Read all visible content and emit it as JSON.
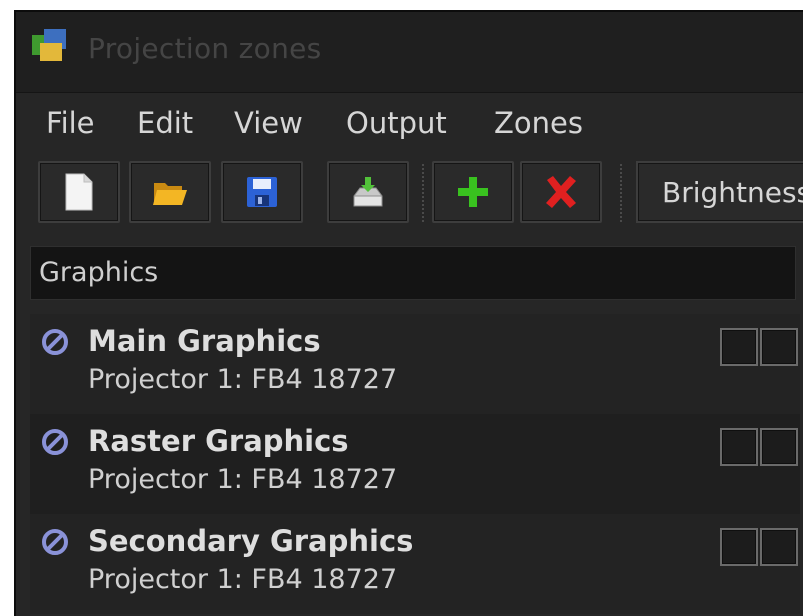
{
  "window": {
    "title": "Projection zones"
  },
  "menu": {
    "items": [
      "File",
      "Edit",
      "View",
      "Output",
      "Zones"
    ]
  },
  "toolbar": {
    "buttons": [
      {
        "icon": "new-document-icon"
      },
      {
        "icon": "open-folder-icon"
      },
      {
        "icon": "save-disk-icon"
      },
      {
        "icon": "export-icon"
      },
      {
        "icon": "add-icon"
      },
      {
        "icon": "delete-icon"
      }
    ],
    "brightness_label": "Brightness"
  },
  "section": {
    "title": "Graphics"
  },
  "zones": [
    {
      "name": "Main Graphics",
      "projector": "Projector 1: FB4 18727"
    },
    {
      "name": "Raster Graphics",
      "projector": "Projector 1: FB4 18727"
    },
    {
      "name": "Secondary Graphics",
      "projector": "Projector 1: FB4 18727"
    }
  ],
  "colors": {
    "window_bg": "#262626",
    "status_icon": "#8a92d8",
    "add_green": "#39c21f",
    "delete_red": "#e02020",
    "folder_yellow": "#f3b624",
    "save_blue": "#2c62d6"
  }
}
